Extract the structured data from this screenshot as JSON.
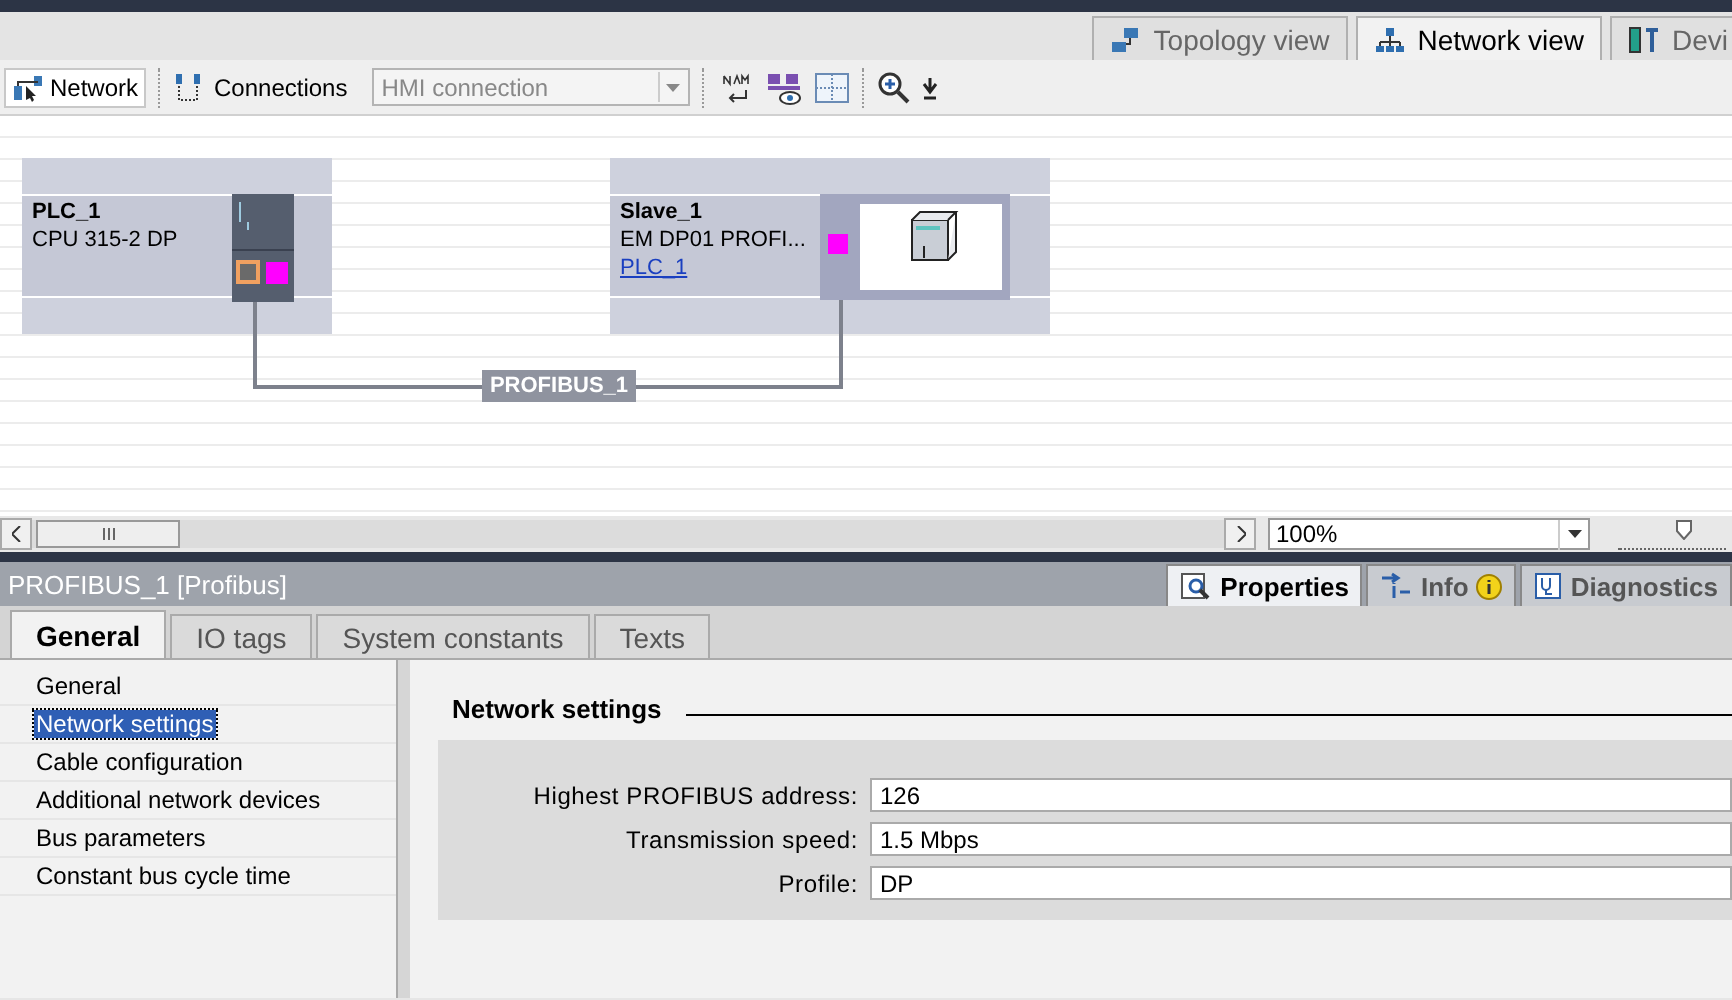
{
  "view_tabs": [
    {
      "label": "Topology view",
      "selected": false,
      "kind": "topology"
    },
    {
      "label": "Network view",
      "selected": true,
      "kind": "network"
    },
    {
      "label": "Devi",
      "selected": false,
      "kind": "device"
    }
  ],
  "toolbar": {
    "network_button": {
      "label": "Network",
      "selected": true
    },
    "connections_label": "Connections",
    "connection_type": {
      "value": "HMI connection",
      "disabled": true
    }
  },
  "devices": [
    {
      "name": "PLC_1",
      "type": "CPU 315-2 DP",
      "kind": "plc"
    },
    {
      "name": "Slave_1",
      "type": "EM  DP01  PROFI...",
      "link": "PLC_1",
      "kind": "slave"
    }
  ],
  "bus": {
    "label": "PROFIBUS_1"
  },
  "zoom": {
    "value": "100%",
    "level": 0.62
  },
  "inspector": {
    "title": "PROFIBUS_1 [Profibus]",
    "tabs": [
      {
        "label": "Properties",
        "selected": true,
        "kind": "properties"
      },
      {
        "label": "Info",
        "selected": false,
        "kind": "info"
      },
      {
        "label": "Diagnostics",
        "selected": false,
        "kind": "diagnostics"
      }
    ],
    "subtabs": [
      {
        "label": "General",
        "selected": true
      },
      {
        "label": "IO tags",
        "selected": false
      },
      {
        "label": "System constants",
        "selected": false
      },
      {
        "label": "Texts",
        "selected": false
      }
    ],
    "nav": [
      {
        "label": "General",
        "selected": false
      },
      {
        "label": "Network settings",
        "selected": true
      },
      {
        "label": "Cable configuration",
        "selected": false
      },
      {
        "label": "Additional network devices",
        "selected": false
      },
      {
        "label": "Bus parameters",
        "selected": false
      },
      {
        "label": "Constant bus cycle time",
        "selected": false
      }
    ],
    "section_title": "Network settings",
    "fields": [
      {
        "label": "Highest PROFIBUS address:",
        "value": "126"
      },
      {
        "label": "Transmission speed:",
        "value": "1.5 Mbps"
      },
      {
        "label": "Profile:",
        "value": "DP"
      }
    ]
  }
}
